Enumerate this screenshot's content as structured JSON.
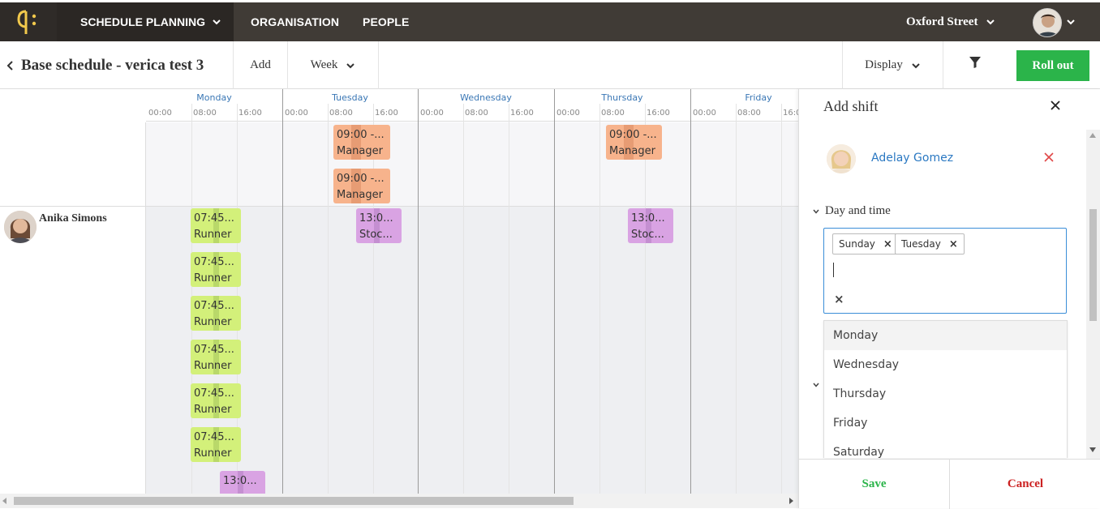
{
  "nav": {
    "active_label": "SCHEDULE PLANNING",
    "organisation": "ORGANISATION",
    "people": "PEOPLE",
    "store": "Oxford Street"
  },
  "toolbar": {
    "title": "Base schedule - verica test 3",
    "add": "Add",
    "view": "Week",
    "display": "Display",
    "roll_out": "Roll out"
  },
  "grid": {
    "days": [
      "Monday",
      "Tuesday",
      "Wednesday",
      "Thursday",
      "Friday"
    ],
    "hours": [
      "00:00",
      "08:00",
      "16:00"
    ],
    "employee": "Anika Simons",
    "unassigned_shifts": [
      {
        "time": "09:00 -...",
        "role": "Manager"
      },
      {
        "time": "09:00 -...",
        "role": "Manager"
      },
      {
        "time": "09:00 -...",
        "role": "Manager"
      }
    ],
    "employee_shifts": {
      "runner": {
        "time": "07:45...",
        "role": "Runner"
      },
      "stock": {
        "time": "13:0...",
        "role": "Stoc..."
      },
      "stock_bottom": {
        "time": "13:0..."
      }
    }
  },
  "panel": {
    "title": "Add shift",
    "person": "Adelay Gomez",
    "section": "Day and time",
    "selected_days": [
      "Sunday",
      "Tuesday"
    ],
    "options": [
      "Monday",
      "Wednesday",
      "Thursday",
      "Friday",
      "Saturday"
    ],
    "save": "Save",
    "cancel": "Cancel"
  },
  "colors": {
    "topbar": "#403b36",
    "accent_link": "#2a78c2",
    "roll_out": "#2bb44a",
    "save": "#2bb44a",
    "cancel": "#cc2222",
    "shift_orange": "#f7b38c",
    "shift_green": "#d3f07a",
    "shift_purple": "#d9a3e3"
  }
}
